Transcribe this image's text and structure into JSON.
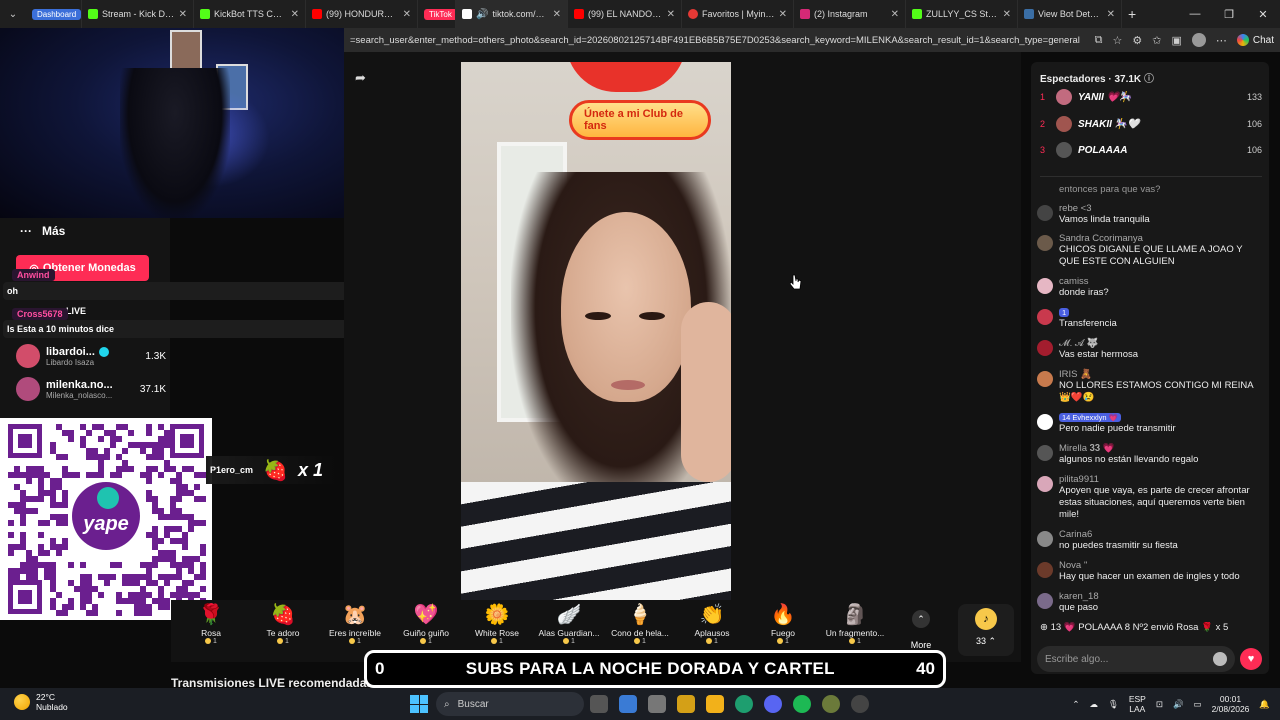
{
  "browser": {
    "tabs": [
      {
        "label": "Dashboard",
        "chip_color": "#3b6fd9",
        "chip": true
      },
      {
        "label": "Stream - Kick Dashbo",
        "fav": "#53fc18"
      },
      {
        "label": "KickBot TTS Comma",
        "fav": "#53fc18"
      },
      {
        "label": "(99) HONDURAS VS",
        "fav": "#ff0000"
      },
      {
        "label": "TikTok",
        "chip_color": "#fe2c55",
        "chip": true
      },
      {
        "label": "tiktok.com/@mi",
        "fav": "#ffffff",
        "active": true
      },
      {
        "label": "(99) EL NANDO FEST",
        "fav": "#ff0000"
      },
      {
        "label": "Favoritos | Myinstant",
        "fav": "#e53935"
      },
      {
        "label": "(2) Instagram",
        "fav": "#d62976"
      },
      {
        "label": "ZULLYY_CS Stream -",
        "fav": "#53fc18"
      },
      {
        "label": "View Bot Detection",
        "fav": "#3a6ea5"
      }
    ],
    "new_tab": "+",
    "url": "=search_user&enter_method=others_photo&search_id=20260802125714BF491EB6B5B75E7D0253&search_keyword=MILENKA&search_result_id=1&search_type=general",
    "chat_label": "Chat"
  },
  "left": {
    "more_label": "Más",
    "coins_label": "Obtener Monedas",
    "overlay_user1": "Anwind",
    "overlay_msg1": "oh",
    "overlay_user2": "Cross5678",
    "overlay_msg2": "Is Esta a 10 minutos dice",
    "live_label": "LIVE",
    "accounts": [
      {
        "name": "libardoi...",
        "handle": "Libardo Isaza",
        "count": "1.3K",
        "verified": true,
        "color": "#d24d6a"
      },
      {
        "name": "milenka.no...",
        "handle": "Milenka_nolasco...",
        "count": "37.1K",
        "verified": false,
        "color": "#b04b7c"
      }
    ]
  },
  "qr": {
    "brand": "yape",
    "color": "#6b1f8f"
  },
  "gift_notice": {
    "user": "P1ero_cm",
    "multiplier": "x 1"
  },
  "video": {
    "fan_badge": "Únete a mi Club de fans"
  },
  "gifts": [
    {
      "name": "Rosa",
      "price": "1",
      "icon": "🌹"
    },
    {
      "name": "Te adoro",
      "price": "1",
      "icon": "🍓"
    },
    {
      "name": "Eres increíble",
      "price": "1",
      "icon": "🐹"
    },
    {
      "name": "Guiño guiño",
      "price": "1",
      "icon": "💖"
    },
    {
      "name": "White Rose",
      "price": "1",
      "icon": "🌼"
    },
    {
      "name": "Alas Guardian...",
      "price": "1",
      "icon": "🪽"
    },
    {
      "name": "Cono de hela...",
      "price": "1",
      "icon": "🍦"
    },
    {
      "name": "Aplausos",
      "price": "1",
      "icon": "👏"
    },
    {
      "name": "Fuego",
      "price": "1",
      "icon": "🔥"
    },
    {
      "name": "Un fragmento...",
      "price": "1",
      "icon": "🗿"
    }
  ],
  "more_label": "More",
  "coin_balance": "33",
  "recommended": "Transmisiones LIVE recomendadas",
  "subs_overlay": {
    "left": "0",
    "text": "SUBS PARA LA NOCHE DORADA Y CARTEL",
    "right": "40"
  },
  "right": {
    "title": "Espectadores · 37.1K",
    "viewers": [
      {
        "rank": "1",
        "name": "YANII 💗🎠",
        "score": "133",
        "color": "#c26b7f"
      },
      {
        "rank": "2",
        "name": "SHAKII 🎠🤍",
        "score": "106",
        "color": "#a0554f"
      },
      {
        "rank": "3",
        "name": "POLAAAA",
        "score": "106",
        "color": "#555555"
      }
    ],
    "partial_msg": "entonces para que vas?",
    "comments": [
      {
        "user": "rebe <3",
        "text": "Vamos linda tranquila",
        "color": "#444"
      },
      {
        "user": "Sandra Ccorimanya",
        "text": "CHICOS DIGANLE QUE LLAME A JOAO Y QUE ESTE CON ALGUIEN",
        "color": "#6b5a4a"
      },
      {
        "user": "camiss",
        "text": "donde iras?",
        "color": "#e6b7c4"
      },
      {
        "user": "1",
        "text": "Transferencia",
        "color": "#c9394d",
        "badge": true
      },
      {
        "user": "𝓜. 𝓐 🐺",
        "text": "Vas estar hermosa",
        "color": "#a31d2e"
      },
      {
        "user": "IRIS 🧸",
        "text": "NO LLORES ESTAMOS CONTIGO MI REINA 👑❤️😢",
        "color": "#c77a4d"
      },
      {
        "user": "14 Evhexxlyn 💗",
        "text": "Pero nadie puede transmitir",
        "color": "#ffffff",
        "badge": true
      },
      {
        "user": "Mirella 𝟑𝟑 💗",
        "text": "algunos no están llevando regalo",
        "color": "#555"
      },
      {
        "user": "pilita9911",
        "text": "Apoyen que vaya, es parte de crecer afrontar estas situaciones, aquí queremos verte bien mile!",
        "color": "#d9a7b9"
      },
      {
        "user": "Carina6",
        "text": "no puedes trasmitir su fiesta",
        "color": "#888"
      },
      {
        "user": "Nova ''",
        "text": "Hay que hacer un examen de ingles y todo",
        "color": "#6b3a2a"
      },
      {
        "user": "karen_18",
        "text": "que paso",
        "color": "#7a6a8a"
      }
    ],
    "gift_line": "13 💗 POLAAAA 8 Nº2 envió Rosa 🌹 x 5",
    "input_placeholder": "Escribe algo..."
  },
  "taskbar": {
    "temp": "22°C",
    "weather": "Nublado",
    "search": "Buscar",
    "lang1": "ESP",
    "lang2": "LAA",
    "time": "00:01",
    "date": "2/08/2026"
  }
}
